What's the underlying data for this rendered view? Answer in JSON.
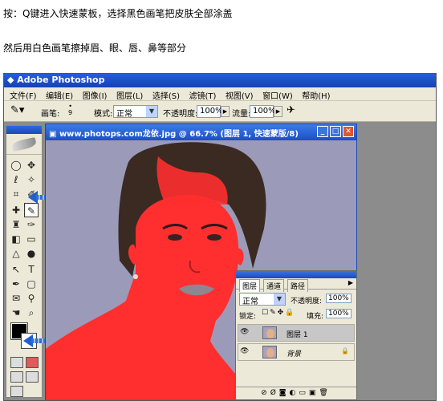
{
  "instructions": {
    "line1": "按：Q键进入快速蒙板，选择黑色画笔把皮肤全部涂盖",
    "line2": "然后用白色画笔擦掉眉、眼、唇、鼻等部分"
  },
  "app": {
    "title": "Adobe Photoshop",
    "menu": [
      "文件(F)",
      "编辑(E)",
      "图像(I)",
      "图层(L)",
      "选择(S)",
      "滤镜(T)",
      "视图(V)",
      "窗口(W)",
      "帮助(H)"
    ]
  },
  "options_bar": {
    "brush_label": "画笔:",
    "brush_size": "9",
    "mode_label": "模式:",
    "mode_value": "正常",
    "opacity_label": "不透明度:",
    "opacity_value": "100%",
    "flow_label": "流量:",
    "flow_value": "100%"
  },
  "document": {
    "title": "www.photops.com龙依.jpg @ 66.7% (图层 1, 快速蒙版/8)"
  },
  "layers_panel": {
    "tabs": [
      "图层",
      "通道",
      "路径"
    ],
    "blend_mode": "正常",
    "opacity_label": "不透明度:",
    "opacity_value": "100%",
    "lock_label": "锁定:",
    "fill_label": "填充:",
    "fill_value": "100%",
    "layers": [
      {
        "name": "图层 1",
        "selected": true,
        "locked": false
      },
      {
        "name": "背景",
        "selected": false,
        "locked": true
      }
    ]
  },
  "colors": {
    "mask_overlay": "#ff2f2f",
    "canvas_bg": "#9a9ab8",
    "title_blue": "#1f55cc",
    "arrow_blue": "#2d6fd6"
  },
  "icons": {
    "brush": "brush-icon",
    "quick_mask": "quick-mask-icon",
    "eye": "eye-icon",
    "lock": "lock-icon"
  }
}
